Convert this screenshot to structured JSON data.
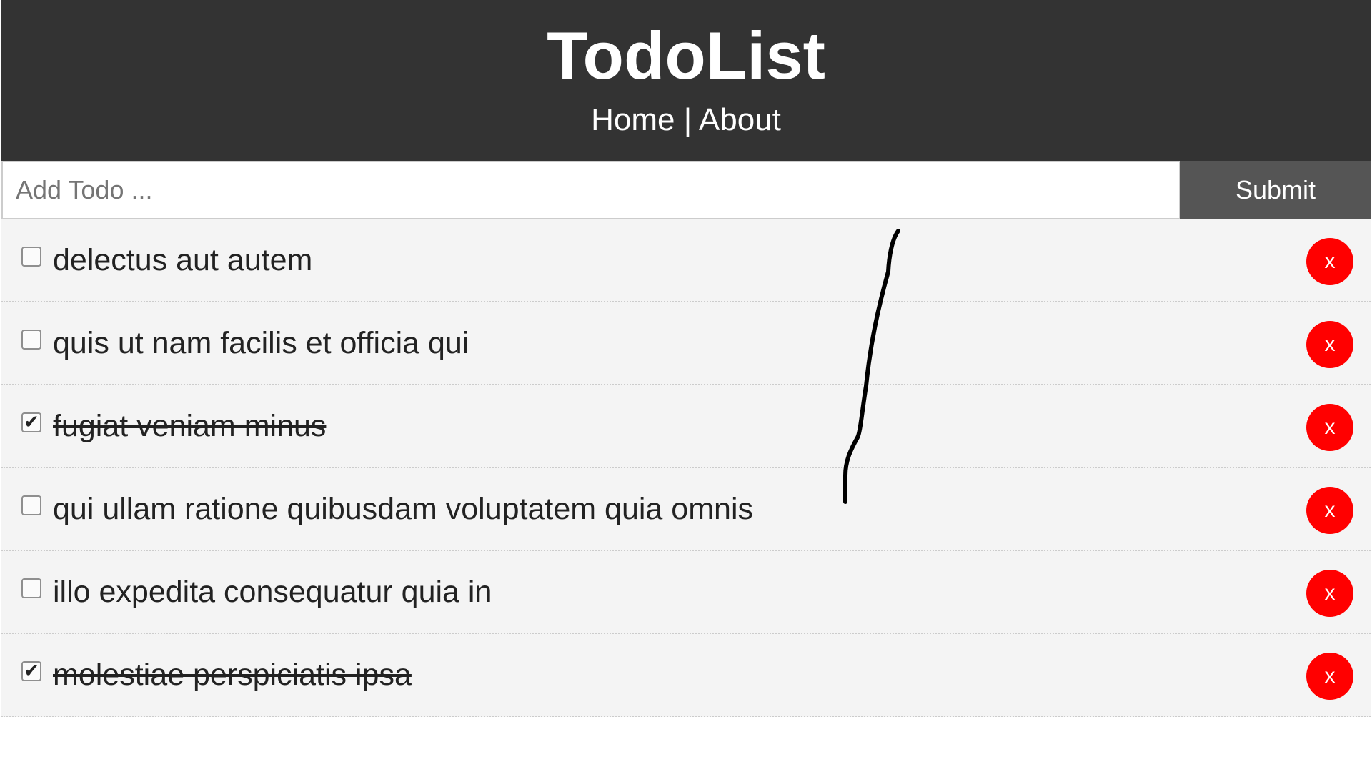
{
  "header": {
    "title": "TodoList",
    "nav_home": "Home",
    "nav_separator": " | ",
    "nav_about": "About"
  },
  "add_form": {
    "placeholder": "Add Todo ...",
    "value": "",
    "submit_label": "Submit"
  },
  "todos": [
    {
      "title": "delectus aut autem",
      "completed": false,
      "check_glyph": "",
      "delete_label": "x"
    },
    {
      "title": "quis ut nam facilis et officia qui",
      "completed": false,
      "check_glyph": "",
      "delete_label": "x"
    },
    {
      "title": "fugiat veniam minus",
      "completed": true,
      "check_glyph": "✔",
      "delete_label": "x"
    },
    {
      "title": "qui ullam ratione quibusdam voluptatem quia omnis",
      "completed": false,
      "check_glyph": "",
      "delete_label": "x"
    },
    {
      "title": "illo expedita consequatur quia in",
      "completed": false,
      "check_glyph": "",
      "delete_label": "x"
    },
    {
      "title": "molestiae perspiciatis ipsa",
      "completed": true,
      "check_glyph": "✔",
      "delete_label": "x"
    }
  ],
  "colors": {
    "header_bg": "#333333",
    "submit_bg": "#555555",
    "item_bg": "#f4f4f4",
    "delete_bg": "#ff0000"
  }
}
